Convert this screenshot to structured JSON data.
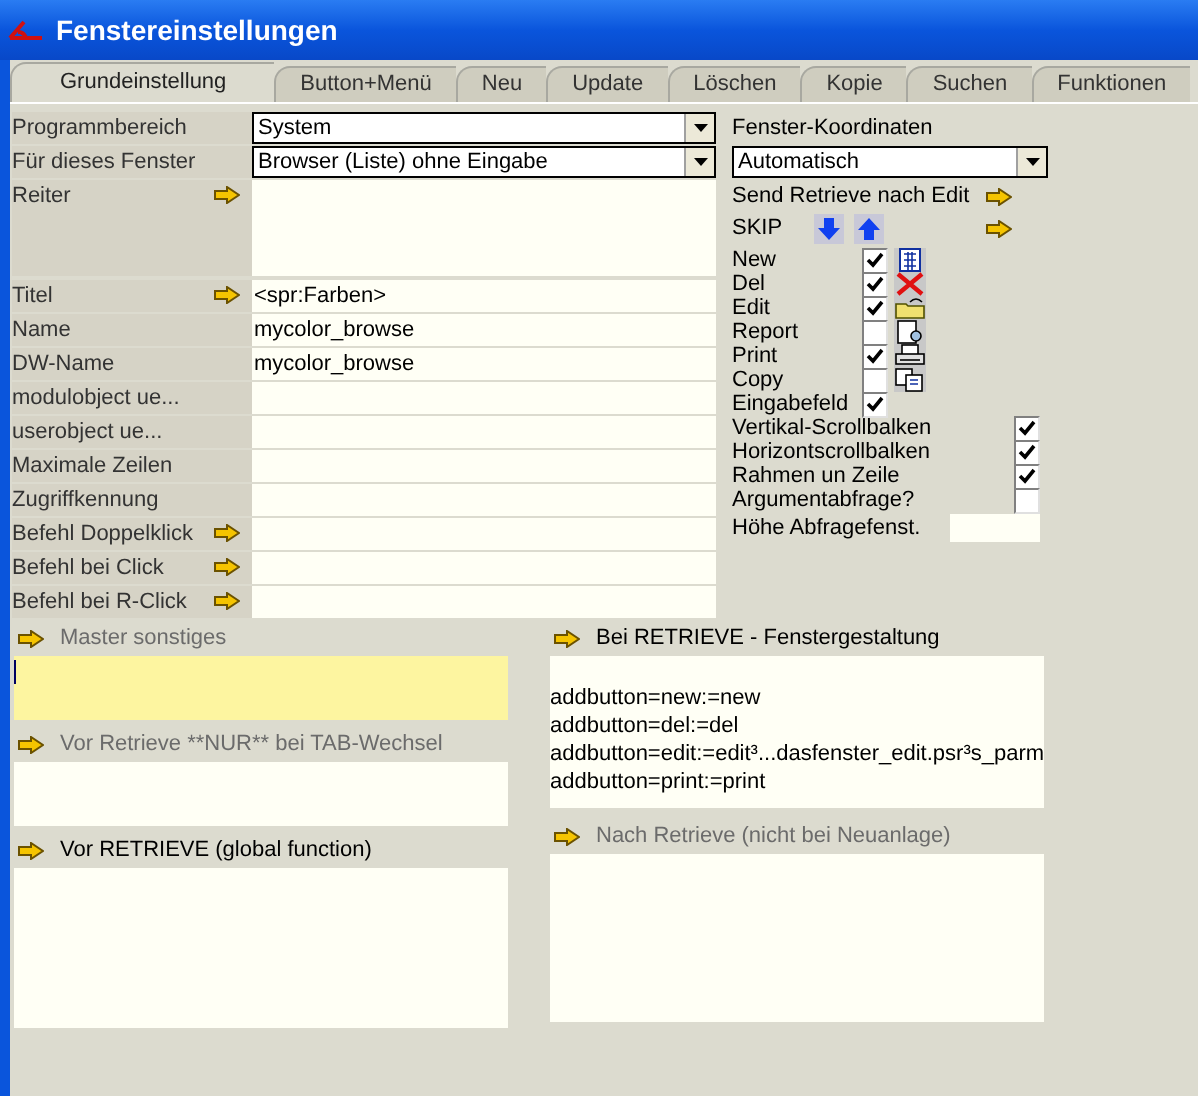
{
  "window": {
    "title": "Fenstereinstellungen"
  },
  "tabs": [
    {
      "label": "Grundeinstellung",
      "selected": true
    },
    {
      "label": "Button+Menü",
      "selected": false
    },
    {
      "label": "Neu",
      "selected": false
    },
    {
      "label": "Update",
      "selected": false
    },
    {
      "label": "Löschen",
      "selected": false
    },
    {
      "label": "Kopie",
      "selected": false
    },
    {
      "label": "Suchen",
      "selected": false
    },
    {
      "label": "Funktionen",
      "selected": false
    }
  ],
  "fields": [
    {
      "label": "Programmbereich",
      "kind": "dropdown",
      "value": "System",
      "arrow": false
    },
    {
      "label": "Für dieses Fenster",
      "kind": "dropdown",
      "value": "Browser (Liste) ohne Eingabe",
      "arrow": false
    },
    {
      "label": "Reiter",
      "kind": "multiline",
      "arrow": true
    },
    {
      "label": "Titel",
      "kind": "text",
      "value": "<spr:Farben>",
      "arrow": true
    },
    {
      "label": "Name",
      "kind": "text",
      "value": "mycolor_browse",
      "arrow": false
    },
    {
      "label": "DW-Name",
      "kind": "text",
      "value": "mycolor_browse",
      "arrow": false
    },
    {
      "label": "modulobject ue...",
      "kind": "text",
      "arrow": false
    },
    {
      "label": "userobject ue...",
      "kind": "text",
      "arrow": false
    },
    {
      "label": "Maximale Zeilen",
      "kind": "text",
      "arrow": false
    },
    {
      "label": "Zugriffkennung",
      "kind": "text",
      "arrow": false
    },
    {
      "label": "Befehl Doppelklick",
      "kind": "text",
      "arrow": true
    },
    {
      "label": "Befehl bei Click",
      "kind": "text",
      "arrow": true
    },
    {
      "label": "Befehl bei R-Click",
      "kind": "text",
      "arrow": true
    }
  ],
  "coordinates": {
    "label": "Fenster-Koordinaten",
    "value": "Automatisch"
  },
  "send_retrieve": {
    "label": "Send Retrieve nach Edit"
  },
  "skip": {
    "label": "SKIP"
  },
  "options": [
    {
      "label": "New",
      "kind": "action",
      "checked": true
    },
    {
      "label": "Del",
      "kind": "action",
      "checked": true
    },
    {
      "label": "Edit",
      "kind": "action",
      "checked": true
    },
    {
      "label": "Report",
      "kind": "action",
      "checked": false
    },
    {
      "label": "Print",
      "kind": "action",
      "checked": true
    },
    {
      "label": "Copy",
      "kind": "action",
      "checked": false
    },
    {
      "label": "Eingabefeld",
      "kind": "flag",
      "checked": true
    },
    {
      "label": "Vertikal-Scrollbalken",
      "kind": "option",
      "checked": true
    },
    {
      "label": "Horizontscrollbalken",
      "kind": "option",
      "checked": true
    },
    {
      "label": "Rahmen un Zeile",
      "kind": "option",
      "checked": true
    },
    {
      "label": "Argumentabfrage?",
      "kind": "option",
      "checked": false
    },
    {
      "label": "Höhe Abfragefenst.",
      "kind": "input"
    }
  ],
  "left_panels": [
    {
      "label": "Master sonstiges",
      "disabled": true,
      "focused": true
    },
    {
      "label": "Vor Retrieve **NUR** bei TAB-Wechsel",
      "disabled": true,
      "focused": false
    },
    {
      "label": "Vor RETRIEVE (global function)",
      "disabled": false,
      "focused": false
    }
  ],
  "right_panels": [
    {
      "label": "Bei RETRIEVE - Fenstergestaltung",
      "disabled": false,
      "focused": false,
      "lines": [
        "addbutton=new:=new",
        "addbutton=del:=del",
        "addbutton=edit:=edit³...dasfenster_edit.psr³s_parm",
        "addbutton=print:=print"
      ]
    },
    {
      "label": "Nach Retrieve (nicht bei Neuanlage)",
      "disabled": true,
      "focused": false
    }
  ]
}
